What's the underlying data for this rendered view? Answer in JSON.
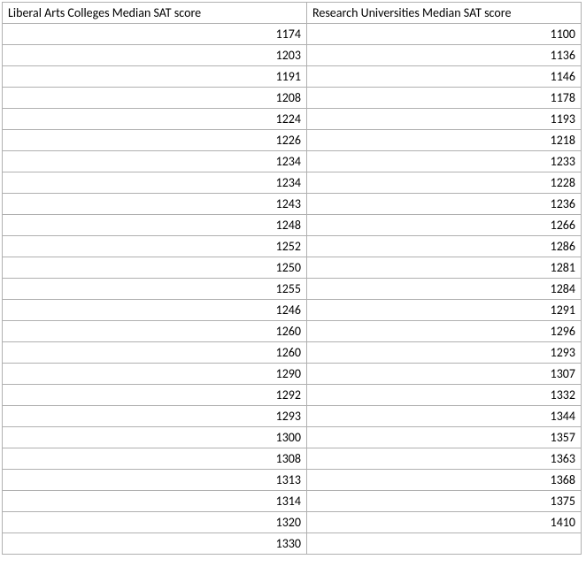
{
  "headers": {
    "col_a": "Liberal Arts Colleges Median SAT score",
    "col_b": "Research Universities Median SAT score"
  },
  "rows": [
    {
      "a": "1174",
      "b": "1100"
    },
    {
      "a": "1203",
      "b": "1136"
    },
    {
      "a": "1191",
      "b": "1146"
    },
    {
      "a": "1208",
      "b": "1178"
    },
    {
      "a": "1224",
      "b": "1193"
    },
    {
      "a": "1226",
      "b": "1218"
    },
    {
      "a": "1234",
      "b": "1233"
    },
    {
      "a": "1234",
      "b": "1228"
    },
    {
      "a": "1243",
      "b": "1236"
    },
    {
      "a": "1248",
      "b": "1266"
    },
    {
      "a": "1252",
      "b": "1286"
    },
    {
      "a": "1250",
      "b": "1281"
    },
    {
      "a": "1255",
      "b": "1284"
    },
    {
      "a": "1246",
      "b": "1291"
    },
    {
      "a": "1260",
      "b": "1296"
    },
    {
      "a": "1260",
      "b": "1293"
    },
    {
      "a": "1290",
      "b": "1307"
    },
    {
      "a": "1292",
      "b": "1332"
    },
    {
      "a": "1293",
      "b": "1344"
    },
    {
      "a": "1300",
      "b": "1357"
    },
    {
      "a": "1308",
      "b": "1363"
    },
    {
      "a": "1313",
      "b": "1368"
    },
    {
      "a": "1314",
      "b": "1375"
    },
    {
      "a": "1320",
      "b": "1410"
    },
    {
      "a": "1330",
      "b": ""
    }
  ]
}
